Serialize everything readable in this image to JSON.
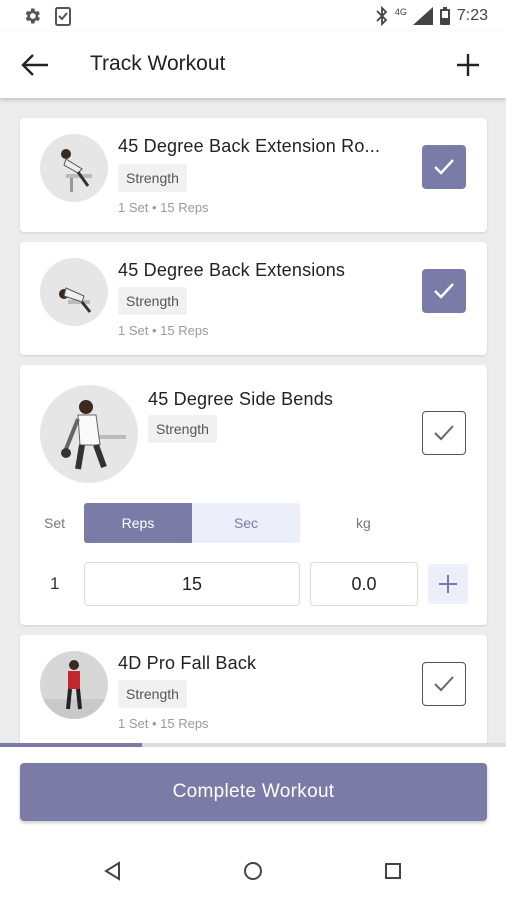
{
  "status_bar": {
    "time": "7:23",
    "network": "4G"
  },
  "app_bar": {
    "title": "Track Workout"
  },
  "exercises": [
    {
      "name": "45 Degree Back Extension Ro...",
      "category": "Strength",
      "summary": "1 Set • 15 Reps",
      "completed": true
    },
    {
      "name": "45 Degree Back Extensions",
      "category": "Strength",
      "summary": "1 Set • 15 Reps",
      "completed": true
    },
    {
      "name": "45 Degree Side Bends",
      "category": "Strength",
      "completed": false,
      "tracker": {
        "set_header": "Set",
        "mode_options": [
          "Reps",
          "Sec"
        ],
        "selected_mode": "Reps",
        "weight_header": "kg",
        "rows": [
          {
            "set": "1",
            "reps": "15",
            "weight": "0.0"
          }
        ]
      }
    },
    {
      "name": "4D Pro Fall Back",
      "category": "Strength",
      "summary": "1 Set • 15 Reps",
      "completed": false
    }
  ],
  "progress": 0.28,
  "complete_button": "Complete Workout",
  "colors": {
    "accent": "#7b7ba8",
    "background": "#ececec"
  }
}
